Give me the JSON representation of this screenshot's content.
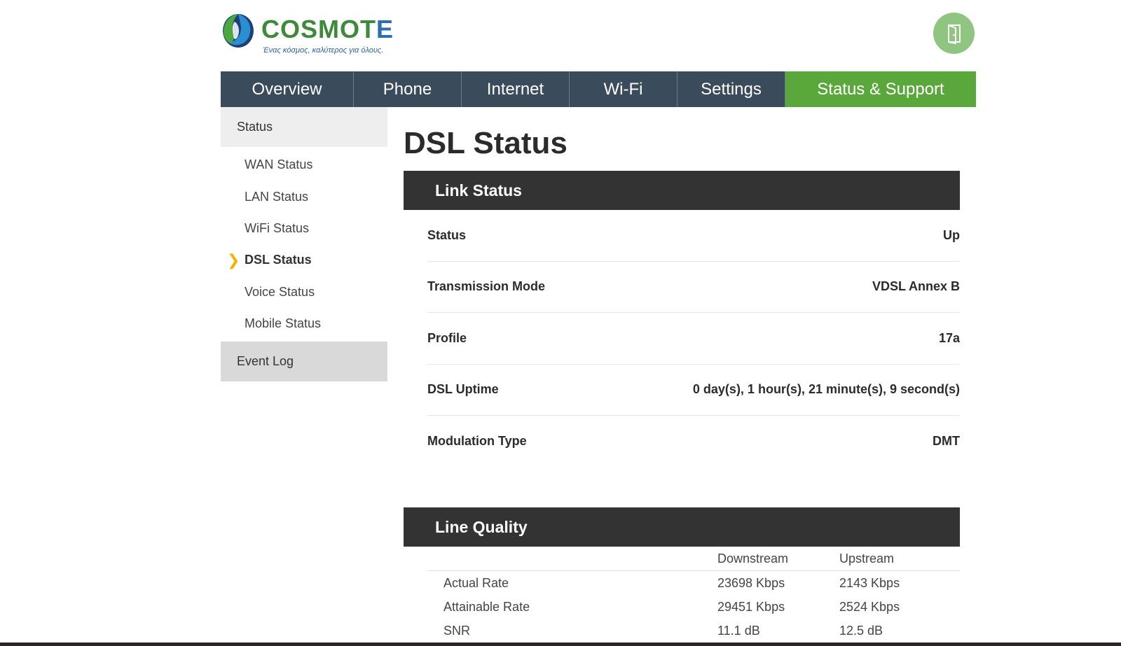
{
  "brand": {
    "name_main": "COSMOT",
    "name_e": "E",
    "tagline": "Ένας κόσμος, καλύτερος για όλους.",
    "colors": {
      "green": "#3e8a3a",
      "blue": "#2a6fb0"
    }
  },
  "header": {
    "logout_icon": "door-exit-icon"
  },
  "nav": {
    "items": [
      {
        "label": "Overview"
      },
      {
        "label": "Phone"
      },
      {
        "label": "Internet"
      },
      {
        "label": "Wi-Fi"
      },
      {
        "label": "Settings"
      },
      {
        "label": "Status & Support",
        "active": true
      }
    ],
    "colors": {
      "default": "#3a4c5c",
      "active": "#5aa83c"
    }
  },
  "sidebar": {
    "header": "Status",
    "items": [
      {
        "label": "WAN Status"
      },
      {
        "label": "LAN Status"
      },
      {
        "label": "WiFi Status"
      },
      {
        "label": "DSL Status",
        "active": true
      },
      {
        "label": "Voice Status"
      },
      {
        "label": "Mobile Status"
      }
    ],
    "footer": "Event Log",
    "active_marker": "❯"
  },
  "main": {
    "title": "DSL Status",
    "link_status": {
      "heading": "Link Status",
      "rows": [
        {
          "label": "Status",
          "value": "Up"
        },
        {
          "label": "Transmission Mode",
          "value": "VDSL Annex B"
        },
        {
          "label": "Profile",
          "value": "17a"
        },
        {
          "label": "DSL Uptime",
          "value": "0 day(s), 1 hour(s), 21 minute(s), 9 second(s)"
        },
        {
          "label": "Modulation Type",
          "value": "DMT"
        }
      ]
    },
    "line_quality": {
      "heading": "Line Quality",
      "columns": [
        "",
        "Downstream",
        "Upstream"
      ],
      "rows": [
        {
          "label": "Actual Rate",
          "down": "23698 Kbps",
          "up": "2143 Kbps"
        },
        {
          "label": "Attainable Rate",
          "down": "29451 Kbps",
          "up": "2524 Kbps"
        },
        {
          "label": "SNR",
          "down": "11.1 dB",
          "up": "12.5 dB"
        }
      ]
    }
  }
}
